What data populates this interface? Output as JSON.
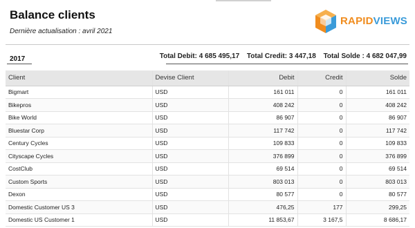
{
  "report": {
    "title": "Balance clients",
    "subtitle": "Dernière actualisation : avril 2021"
  },
  "logo": {
    "text_part1": "RAPID",
    "text_part2": "VIEWS",
    "icon": "cube-logo-icon",
    "colors": {
      "orange": "#f08c1e",
      "blue": "#3a9bd9"
    }
  },
  "summary": {
    "year": "2017",
    "total_debit": "Total Debit: 4 685 495,17",
    "total_credit": "Total Credit: 3 447,18",
    "total_solde": "Total Solde : 4 682 047,99"
  },
  "table": {
    "headers": {
      "client": "Client",
      "currency": "Devise Client",
      "debit": "Debit",
      "credit": "Credit",
      "solde": "Solde"
    },
    "rows": [
      {
        "client": "Bigmart",
        "currency": "USD",
        "debit": "161 011",
        "credit": "0",
        "solde": "161 011"
      },
      {
        "client": "Bikepros",
        "currency": "USD",
        "debit": "408 242",
        "credit": "0",
        "solde": "408 242"
      },
      {
        "client": "Bike World",
        "currency": "USD",
        "debit": "86 907",
        "credit": "0",
        "solde": "86 907"
      },
      {
        "client": "Bluestar Corp",
        "currency": "USD",
        "debit": "117 742",
        "credit": "0",
        "solde": "117 742"
      },
      {
        "client": "Century Cycles",
        "currency": "USD",
        "debit": "109 833",
        "credit": "0",
        "solde": "109 833"
      },
      {
        "client": "Cityscape Cycles",
        "currency": "USD",
        "debit": "376 899",
        "credit": "0",
        "solde": "376 899"
      },
      {
        "client": "CostClub",
        "currency": "USD",
        "debit": "69 514",
        "credit": "0",
        "solde": "69 514"
      },
      {
        "client": "Custom Sports",
        "currency": "USD",
        "debit": "803 013",
        "credit": "0",
        "solde": "803 013"
      },
      {
        "client": "Dexon",
        "currency": "USD",
        "debit": "80 577",
        "credit": "0",
        "solde": "80 577"
      },
      {
        "client": "Domestic Customer US 3",
        "currency": "USD",
        "debit": "476,25",
        "credit": "177",
        "solde": "299,25"
      },
      {
        "client": "Domestic US Customer 1",
        "currency": "USD",
        "debit": "11 853,67",
        "credit": "3 167,5",
        "solde": "8 686,17"
      }
    ]
  }
}
